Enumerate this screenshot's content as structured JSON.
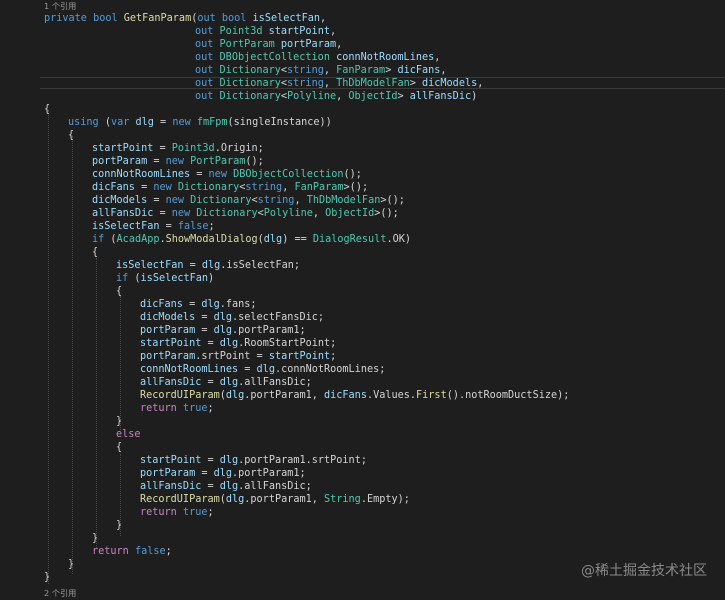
{
  "editor": {
    "codelens_top": "1 个引用",
    "codelens_bottom": "2 个引用",
    "watermark": "@稀土掘金技术社区",
    "colors": {
      "background": "#1e1e1e",
      "keyword": "#569cd6",
      "type": "#4ec9b0",
      "method": "#dcdcaa",
      "variable": "#9cdcfe",
      "text": "#d4d4d4"
    },
    "lines": [
      [
        [
          "private bool ",
          "kw"
        ],
        [
          "GetFanParam",
          "fn"
        ],
        [
          "(",
          "pu"
        ],
        [
          "out bool ",
          "kw"
        ],
        [
          "isSelectFan",
          "pa"
        ],
        [
          ",",
          "pu"
        ]
      ],
      [
        [
          "out ",
          "kw"
        ],
        [
          "Point3d ",
          "ty"
        ],
        [
          "startPoint",
          "pa"
        ],
        [
          ",",
          "pu"
        ]
      ],
      [
        [
          "out ",
          "kw"
        ],
        [
          "PortParam ",
          "ty"
        ],
        [
          "portParam",
          "pa"
        ],
        [
          ",",
          "pu"
        ]
      ],
      [
        [
          "out ",
          "kw"
        ],
        [
          "DBObjectCollection ",
          "ty"
        ],
        [
          "connNotRoomLines",
          "pa"
        ],
        [
          ",",
          "pu"
        ]
      ],
      [
        [
          "out ",
          "kw"
        ],
        [
          "Dictionary",
          "ty"
        ],
        [
          "<",
          "pu"
        ],
        [
          "string",
          "kw"
        ],
        [
          ", ",
          "pu"
        ],
        [
          "FanParam",
          "ty"
        ],
        [
          "> ",
          "pu"
        ],
        [
          "dicFans",
          "pa"
        ],
        [
          ",",
          "pu"
        ]
      ],
      [
        [
          "out ",
          "kw"
        ],
        [
          "Dictionary",
          "ty"
        ],
        [
          "<",
          "pu"
        ],
        [
          "string",
          "kw"
        ],
        [
          ", ",
          "pu"
        ],
        [
          "ThDbModelFan",
          "ty"
        ],
        [
          "> ",
          "pu"
        ],
        [
          "dicModels",
          "pa"
        ],
        [
          ",",
          "pu"
        ]
      ],
      [
        [
          "out ",
          "kw"
        ],
        [
          "Dictionary",
          "ty"
        ],
        [
          "<",
          "pu"
        ],
        [
          "Polyline",
          "ty"
        ],
        [
          ", ",
          "pu"
        ],
        [
          "ObjectId",
          "ty"
        ],
        [
          "> ",
          "pu"
        ],
        [
          "allFansDic",
          "pa"
        ],
        [
          ")",
          "pu"
        ]
      ],
      [
        [
          "{",
          "pu"
        ]
      ],
      [
        [
          "using ",
          "kw"
        ],
        [
          "(",
          "pu"
        ],
        [
          "var ",
          "kw"
        ],
        [
          "dlg",
          "lv"
        ],
        [
          " = ",
          "pu"
        ],
        [
          "new ",
          "kw"
        ],
        [
          "fmFpm",
          "ty"
        ],
        [
          "(singleInstance))",
          "pu"
        ]
      ],
      [
        [
          "{",
          "pu"
        ]
      ],
      [
        [
          "startPoint",
          "pa"
        ],
        [
          " = ",
          "pu"
        ],
        [
          "Point3d",
          "ty"
        ],
        [
          ".Origin;",
          "pu"
        ]
      ],
      [
        [
          "portParam",
          "pa"
        ],
        [
          " = ",
          "pu"
        ],
        [
          "new ",
          "kw"
        ],
        [
          "PortParam",
          "ty"
        ],
        [
          "();",
          "pu"
        ]
      ],
      [
        [
          "connNotRoomLines",
          "pa"
        ],
        [
          " = ",
          "pu"
        ],
        [
          "new ",
          "kw"
        ],
        [
          "DBObjectCollection",
          "ty"
        ],
        [
          "();",
          "pu"
        ]
      ],
      [
        [
          "dicFans",
          "pa"
        ],
        [
          " = ",
          "pu"
        ],
        [
          "new ",
          "kw"
        ],
        [
          "Dictionary",
          "ty"
        ],
        [
          "<",
          "pu"
        ],
        [
          "string",
          "kw"
        ],
        [
          ", ",
          "pu"
        ],
        [
          "FanParam",
          "ty"
        ],
        [
          ">();",
          "pu"
        ]
      ],
      [
        [
          "dicModels",
          "pa"
        ],
        [
          " = ",
          "pu"
        ],
        [
          "new ",
          "kw"
        ],
        [
          "Dictionary",
          "ty"
        ],
        [
          "<",
          "pu"
        ],
        [
          "string",
          "kw"
        ],
        [
          ", ",
          "pu"
        ],
        [
          "ThDbModelFan",
          "ty"
        ],
        [
          ">();",
          "pu"
        ]
      ],
      [
        [
          "allFansDic",
          "pa"
        ],
        [
          " = ",
          "pu"
        ],
        [
          "new ",
          "kw"
        ],
        [
          "Dictionary",
          "ty"
        ],
        [
          "<",
          "pu"
        ],
        [
          "Polyline",
          "ty"
        ],
        [
          ", ",
          "pu"
        ],
        [
          "ObjectId",
          "ty"
        ],
        [
          ">();",
          "pu"
        ]
      ],
      [
        [
          "isSelectFan",
          "pa"
        ],
        [
          " = ",
          "pu"
        ],
        [
          "false",
          "kw"
        ],
        [
          ";",
          "pu"
        ]
      ],
      [
        [
          "if ",
          "kw"
        ],
        [
          "(",
          "pu"
        ],
        [
          "AcadApp",
          "ty"
        ],
        [
          ".",
          "pu"
        ],
        [
          "ShowModalDialog",
          "fn"
        ],
        [
          "(",
          "pu"
        ],
        [
          "dlg",
          "lv"
        ],
        [
          ") == ",
          "pu"
        ],
        [
          "DialogResult",
          "ty"
        ],
        [
          ".OK)",
          "pu"
        ]
      ],
      [
        [
          "{",
          "pu"
        ]
      ],
      [
        [
          "isSelectFan",
          "pa"
        ],
        [
          " = ",
          "pu"
        ],
        [
          "dlg",
          "lv"
        ],
        [
          ".isSelectFan;",
          "pu"
        ]
      ],
      [
        [
          "if ",
          "kw"
        ],
        [
          "(",
          "pu"
        ],
        [
          "isSelectFan",
          "pa"
        ],
        [
          ")",
          "pu"
        ]
      ],
      [
        [
          "{",
          "pu"
        ]
      ],
      [
        [
          "dicFans",
          "pa"
        ],
        [
          " = ",
          "pu"
        ],
        [
          "dlg",
          "lv"
        ],
        [
          ".fans;",
          "pu"
        ]
      ],
      [
        [
          "dicModels",
          "pa"
        ],
        [
          " = ",
          "pu"
        ],
        [
          "dlg",
          "lv"
        ],
        [
          ".selectFansDic;",
          "pu"
        ]
      ],
      [
        [
          "portParam",
          "pa"
        ],
        [
          " = ",
          "pu"
        ],
        [
          "dlg",
          "lv"
        ],
        [
          ".portParam1;",
          "pu"
        ]
      ],
      [
        [
          "startPoint",
          "pa"
        ],
        [
          " = ",
          "pu"
        ],
        [
          "dlg",
          "lv"
        ],
        [
          ".RoomStartPoint;",
          "pu"
        ]
      ],
      [
        [
          "portParam",
          "pa"
        ],
        [
          ".srtPoint = ",
          "pu"
        ],
        [
          "startPoint",
          "pa"
        ],
        [
          ";",
          "pu"
        ]
      ],
      [
        [
          "connNotRoomLines",
          "pa"
        ],
        [
          " = ",
          "pu"
        ],
        [
          "dlg",
          "lv"
        ],
        [
          ".connNotRoomLines;",
          "pu"
        ]
      ],
      [
        [
          "allFansDic",
          "pa"
        ],
        [
          " = ",
          "pu"
        ],
        [
          "dlg",
          "lv"
        ],
        [
          ".allFansDic;",
          "pu"
        ]
      ],
      [
        [
          "RecordUIParam",
          "fn"
        ],
        [
          "(",
          "pu"
        ],
        [
          "dlg",
          "lv"
        ],
        [
          ".portParam1, ",
          "pu"
        ],
        [
          "dicFans",
          "pa"
        ],
        [
          ".Values.",
          "pu"
        ],
        [
          "First",
          "fn"
        ],
        [
          "().notRoomDuctSize);",
          "pu"
        ]
      ],
      [
        [
          "return ",
          "ct"
        ],
        [
          "true",
          "kw"
        ],
        [
          ";",
          "pu"
        ]
      ],
      [
        [
          "}",
          "pu"
        ]
      ],
      [
        [
          "else",
          "ct"
        ]
      ],
      [
        [
          "{",
          "pu"
        ]
      ],
      [
        [
          "startPoint",
          "pa"
        ],
        [
          " = ",
          "pu"
        ],
        [
          "dlg",
          "lv"
        ],
        [
          ".portParam1.srtPoint;",
          "pu"
        ]
      ],
      [
        [
          "portParam",
          "pa"
        ],
        [
          " = ",
          "pu"
        ],
        [
          "dlg",
          "lv"
        ],
        [
          ".portParam1;",
          "pu"
        ]
      ],
      [
        [
          "allFansDic",
          "pa"
        ],
        [
          " = ",
          "pu"
        ],
        [
          "dlg",
          "lv"
        ],
        [
          ".allFansDic;",
          "pu"
        ]
      ],
      [
        [
          "RecordUIParam",
          "fn"
        ],
        [
          "(",
          "pu"
        ],
        [
          "dlg",
          "lv"
        ],
        [
          ".portParam1, ",
          "pu"
        ],
        [
          "String",
          "ty"
        ],
        [
          ".Empty);",
          "pu"
        ]
      ],
      [
        [
          "return ",
          "ct"
        ],
        [
          "true",
          "kw"
        ],
        [
          ";",
          "pu"
        ]
      ],
      [
        [
          "}",
          "pu"
        ]
      ],
      [
        [
          "}",
          "pu"
        ]
      ],
      [
        [
          "return ",
          "ct"
        ],
        [
          "false",
          "kw"
        ],
        [
          ";",
          "pu"
        ]
      ],
      [
        [
          "}",
          "pu"
        ]
      ],
      [
        [
          "}",
          "pu"
        ]
      ]
    ]
  }
}
